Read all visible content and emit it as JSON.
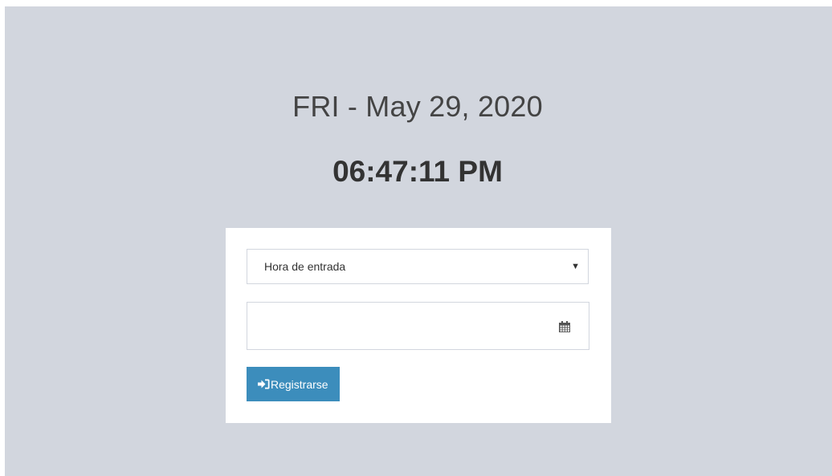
{
  "clock": {
    "date": "FRI - May 29, 2020",
    "time": "06:47:11 PM"
  },
  "form": {
    "attendance_type": {
      "selected": "Hora de entrada",
      "icon": "caret-down-icon"
    },
    "date_field": {
      "value": "",
      "icon": "calendar-icon"
    },
    "submit": {
      "label": "Registrarse",
      "icon": "sign-in-icon",
      "color": "#3c8dbc"
    }
  },
  "colors": {
    "page_background": "#d2d6de",
    "box_background": "#ffffff",
    "accent": "#3c8dbc"
  }
}
